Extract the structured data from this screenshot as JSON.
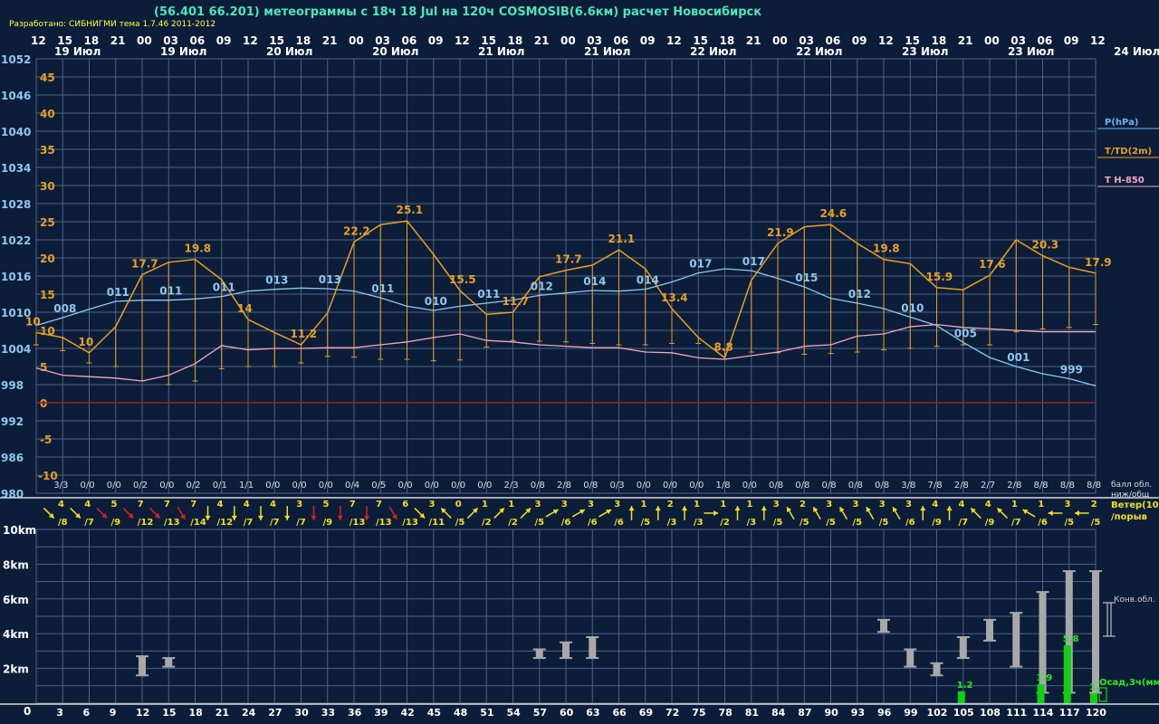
{
  "header": {
    "title": "(56.401 66.201) метеограммы с  18ч 18 Jul на 120ч COSMOSIB(6.6км) расчет Новосибирск",
    "credit": "Разработано: СИБНИГМИ тема 1.7.46 2011-2012"
  },
  "colors": {
    "background": "#0c1d3a",
    "grid": "#4e6284",
    "pressure": "#8ec8f0",
    "temp": "#e8a020",
    "t850": "#f0a8c0",
    "zero_line": "#a02020",
    "wind_normal": "#f0e020",
    "wind_strong": "#e02020",
    "cloud": "#a8a8a8",
    "precip": "#10d010"
  },
  "chart_data": {
    "type": "line",
    "hours": [
      "12",
      "15",
      "18",
      "21",
      "00",
      "03",
      "06",
      "09",
      "12",
      "15",
      "18",
      "21",
      "00",
      "03",
      "06",
      "09",
      "12",
      "15",
      "18",
      "21",
      "00",
      "03",
      "06",
      "09",
      "12",
      "15",
      "18",
      "21",
      "00",
      "03",
      "06",
      "09",
      "12",
      "15",
      "18",
      "21",
      "00",
      "03",
      "06",
      "09",
      "12"
    ],
    "days": [
      "19 Июл",
      "19 Июл",
      "20 Июл",
      "20 Июл",
      "21 Июл",
      "21 Июл",
      "22 Июл",
      "22 Июл",
      "23 Июл",
      "23 Июл",
      "24 Июл"
    ],
    "pressure_axis": [
      "1052",
      "1046",
      "1040",
      "1034",
      "1028",
      "1022",
      "1016",
      "1010",
      "1004",
      "998",
      "992",
      "986",
      "980"
    ],
    "temp_axis": [
      "45",
      "40",
      "35",
      "30",
      "25",
      "20",
      "15",
      "10",
      "5",
      "0",
      "-5",
      "-10"
    ],
    "pressure_ylim": [
      980,
      1052
    ],
    "temp_ylim": [
      -12,
      48
    ],
    "pressure_hpa": [
      1007.8,
      1009.1,
      1010.5,
      1011.8,
      1012.0,
      1012.0,
      1012.2,
      1012.6,
      1013.5,
      1013.8,
      1014.0,
      1013.9,
      1013.5,
      1012.4,
      1011.0,
      1010.3,
      1011.0,
      1011.5,
      1012.0,
      1012.8,
      1013.2,
      1013.6,
      1013.5,
      1013.8,
      1015.0,
      1016.5,
      1017.2,
      1016.9,
      1015.6,
      1014.2,
      1012.3,
      1011.5,
      1010.6,
      1009.2,
      1007.8,
      1005.0,
      1002.5,
      1001.0,
      999.8,
      999.0,
      997.8
    ],
    "temp_c": [
      9.7,
      9.0,
      6.9,
      10.5,
      17.7,
      19.4,
      19.8,
      17.0,
      11.5,
      9.7,
      8.0,
      12.4,
      22.2,
      24.6,
      25.1,
      20.5,
      15.5,
      12.2,
      12.5,
      17.4,
      18.3,
      19.0,
      21.1,
      18.5,
      13.0,
      9.0,
      6.2,
      16.9,
      22.0,
      24.3,
      24.6,
      22.0,
      19.8,
      19.2,
      15.9,
      15.6,
      17.6,
      22.5,
      20.3,
      18.7,
      17.9
    ],
    "dewpoint_c": [
      8.0,
      7.2,
      5.5,
      5.0,
      3.0,
      2.5,
      3.0,
      4.7,
      5.0,
      5.0,
      5.5,
      6.4,
      6.3,
      6.0,
      6.0,
      5.8,
      5.9,
      7.7,
      8.6,
      8.5,
      8.4,
      8.2,
      8.0,
      8.0,
      8.2,
      8.2,
      7.3,
      7.0,
      6.9,
      6.7,
      6.8,
      7.0,
      7.3,
      7.5,
      7.8,
      8.0,
      8.0,
      9.8,
      10.2,
      10.4,
      10.8
    ],
    "t850_c": [
      4.8,
      3.8,
      3.6,
      3.4,
      3.0,
      3.8,
      5.4,
      7.9,
      7.3,
      7.5,
      7.5,
      7.6,
      7.6,
      8.0,
      8.4,
      9.0,
      9.5,
      8.6,
      8.4,
      8.0,
      7.8,
      7.6,
      7.6,
      7.0,
      6.9,
      6.2,
      6.0,
      6.5,
      7.0,
      7.8,
      8.0,
      9.2,
      9.5,
      10.5,
      10.8,
      10.4,
      10.2,
      10.0,
      9.8,
      9.8,
      9.8
    ],
    "pressure_labels": [
      {
        "i": 1,
        "text": "008"
      },
      {
        "i": 3,
        "text": "011"
      },
      {
        "i": 5,
        "text": "011"
      },
      {
        "i": 7,
        "text": "011"
      },
      {
        "i": 9,
        "text": "013"
      },
      {
        "i": 11,
        "text": "013"
      },
      {
        "i": 13,
        "text": "011"
      },
      {
        "i": 15,
        "text": "010"
      },
      {
        "i": 17,
        "text": "011"
      },
      {
        "i": 19,
        "text": "012"
      },
      {
        "i": 21,
        "text": "014"
      },
      {
        "i": 23,
        "text": "014"
      },
      {
        "i": 25,
        "text": "017"
      },
      {
        "i": 27,
        "text": "017"
      },
      {
        "i": 29,
        "text": "015"
      },
      {
        "i": 31,
        "text": "012"
      },
      {
        "i": 33,
        "text": "010"
      },
      {
        "i": 35,
        "text": "005"
      },
      {
        "i": 37,
        "text": "001"
      },
      {
        "i": 39,
        "text": "999"
      }
    ],
    "temp_labels": [
      {
        "i": 0,
        "text": "10"
      },
      {
        "i": 2,
        "text": "10"
      },
      {
        "i": 4,
        "text": "17.7"
      },
      {
        "i": 6,
        "text": "19.8"
      },
      {
        "i": 8,
        "text": "14"
      },
      {
        "i": 10,
        "text": "11.2"
      },
      {
        "i": 12,
        "text": "22.2"
      },
      {
        "i": 14,
        "text": "25.1"
      },
      {
        "i": 16,
        "text": "15.5"
      },
      {
        "i": 18,
        "text": "11.7"
      },
      {
        "i": 20,
        "text": "17.7"
      },
      {
        "i": 22,
        "text": "21.1"
      },
      {
        "i": 24,
        "text": "13.4"
      },
      {
        "i": 26,
        "text": "8.8"
      },
      {
        "i": 28,
        "text": "21.9"
      },
      {
        "i": 30,
        "text": "24.6"
      },
      {
        "i": 32,
        "text": "19.8"
      },
      {
        "i": 34,
        "text": "15.9"
      },
      {
        "i": 36,
        "text": "17.6"
      },
      {
        "i": 38,
        "text": "20.3"
      },
      {
        "i": 40,
        "text": "17.9"
      }
    ],
    "legend": [
      {
        "text": "P(hPa)",
        "color": "#6ab4f0"
      },
      {
        "text": "T/TD(2m)",
        "color": "#e8a020"
      },
      {
        "text": "T H-850",
        "color": "#f0a8c0"
      }
    ],
    "cloud_low_total": [
      "3/3",
      "0/0",
      "0/0",
      "0/2",
      "0/0",
      "0/2",
      "0/1",
      "1/1",
      "0/0",
      "0/0",
      "0/0",
      "0/4",
      "0/5",
      "0/0",
      "0/0",
      "0/0",
      "0/0",
      "2/3",
      "0/8",
      "2/8",
      "0/8",
      "0/3",
      "0/0",
      "0/0",
      "0/0",
      "1/8",
      "0/0",
      "0/8",
      "0/8",
      "0/8",
      "0/8",
      "0/8",
      "3/8",
      "7/8",
      "2/8",
      "2/7",
      "2/8",
      "8/8",
      "8/8",
      "8/8"
    ],
    "cloud_legend": [
      "балл обл.",
      "ниж/общ"
    ],
    "wind_speed": [
      "4",
      "4",
      "5",
      "7",
      "7",
      "7",
      "4",
      "4",
      "4",
      "3",
      "5",
      "7",
      "7",
      "6",
      "3",
      "0",
      "1",
      "1",
      "3",
      "3",
      "3",
      "3",
      "1",
      "2",
      "1",
      "1",
      "1",
      "3",
      "2",
      "3",
      "3",
      "3",
      "3",
      "4",
      "4",
      "4",
      "1",
      "1",
      "3",
      "2"
    ],
    "wind_gust": [
      "/8",
      "/7",
      "/9",
      "/12",
      "/13",
      "/14",
      "/12",
      "/7",
      "/7",
      "/7",
      "/9",
      "/13",
      "/13",
      "/13",
      "/11",
      "/5",
      "/2",
      "/2",
      "/5",
      "/6",
      "/6",
      "/6",
      "/5",
      "/3",
      "/3",
      "/2",
      "/3",
      "/5",
      "/5",
      "/5",
      "/5",
      "/5",
      "/6",
      "/9",
      "/7",
      "/9",
      "/7",
      "/6",
      "/5",
      "/5"
    ],
    "wind_dir_deg": [
      315,
      315,
      315,
      315,
      315,
      300,
      270,
      270,
      270,
      270,
      270,
      270,
      270,
      300,
      315,
      135,
      45,
      45,
      45,
      30,
      30,
      30,
      90,
      90,
      90,
      0,
      90,
      90,
      120,
      120,
      120,
      120,
      120,
      90,
      90,
      135,
      135,
      150,
      180,
      180
    ],
    "wind_strong_min": 5,
    "wind_legend": [
      "Ветер(10м)",
      "/порыв"
    ],
    "height_axis": [
      "10km",
      "8km",
      "6km",
      "4km",
      "2km",
      "0"
    ],
    "step_hours": [
      "3",
      "6",
      "9",
      "12",
      "15",
      "18",
      "21",
      "24",
      "27",
      "30",
      "33",
      "36",
      "39",
      "42",
      "45",
      "48",
      "51",
      "54",
      "57",
      "60",
      "63",
      "66",
      "69",
      "72",
      "75",
      "78",
      "81",
      "84",
      "87",
      "90",
      "93",
      "96",
      "99",
      "102",
      "105",
      "108",
      "111",
      "114",
      "117",
      "120"
    ],
    "conv_clouds": [
      {
        "h": 12,
        "base_km": 1.6,
        "top_km": 2.7
      },
      {
        "h": 15,
        "base_km": 2.1,
        "top_km": 2.6
      },
      {
        "h": 57,
        "base_km": 2.6,
        "top_km": 3.1
      },
      {
        "h": 60,
        "base_km": 2.6,
        "top_km": 3.5
      },
      {
        "h": 63,
        "base_km": 2.6,
        "top_km": 3.8
      },
      {
        "h": 96,
        "base_km": 4.1,
        "top_km": 4.8
      },
      {
        "h": 99,
        "base_km": 2.1,
        "top_km": 3.1
      },
      {
        "h": 102,
        "base_km": 1.6,
        "top_km": 2.3
      },
      {
        "h": 105,
        "base_km": 2.6,
        "top_km": 3.8
      },
      {
        "h": 108,
        "base_km": 3.6,
        "top_km": 4.8
      },
      {
        "h": 111,
        "base_km": 2.1,
        "top_km": 5.2
      },
      {
        "h": 114,
        "base_km": 0.6,
        "top_km": 6.4
      },
      {
        "h": 117,
        "base_km": 0.6,
        "top_km": 7.6
      },
      {
        "h": 120,
        "base_km": 0.6,
        "top_km": 7.6
      }
    ],
    "conv_legend": "Конв.обл.",
    "precip": [
      {
        "h": 105,
        "mm": 1.2,
        "label": "1.2"
      },
      {
        "h": 114,
        "mm": 1.9,
        "label": "1.9"
      },
      {
        "h": 117,
        "mm": 5.8,
        "label": "5.8"
      },
      {
        "h": 120,
        "mm": 1.0,
        "label": "1."
      }
    ],
    "precip_legend": "Осад,3ч(мм)"
  }
}
